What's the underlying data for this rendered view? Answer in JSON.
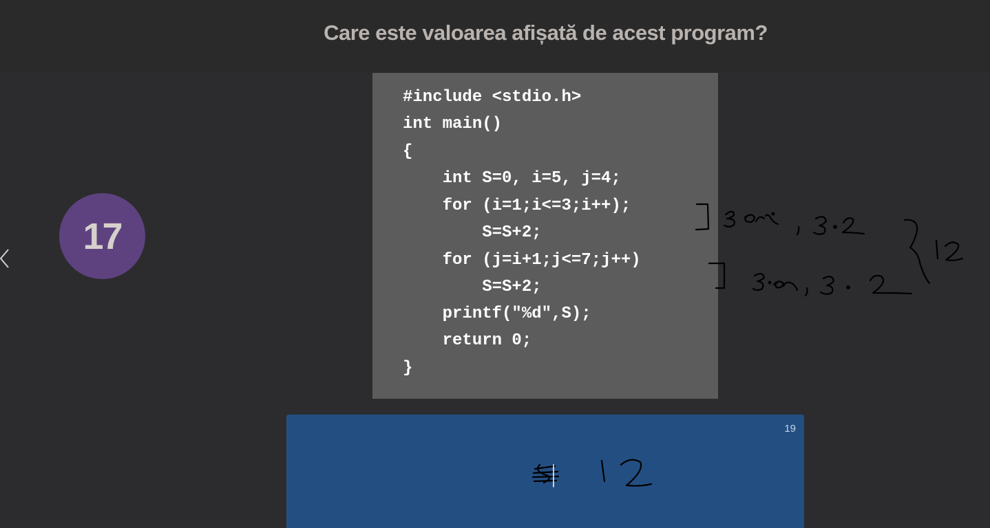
{
  "question": {
    "title": "Care este valoarea afișată de acest program?"
  },
  "navigation": {
    "prev_icon": "chevron-left-icon"
  },
  "badge": {
    "number": "17",
    "color": "#5e4280"
  },
  "code": {
    "lines": [
      "#include <stdio.h>",
      "int main()",
      "{",
      "    int S=0, i=5, j=4;",
      "    for (i=1;i<=3;i++);",
      "        S=S+2;",
      "    for (j=i+1;j<=7;j++)",
      "        S=S+2;",
      "    printf(\"%d\",S);",
      "    return 0;",
      "}"
    ]
  },
  "answer": {
    "count": "19",
    "color": "#234e82"
  }
}
